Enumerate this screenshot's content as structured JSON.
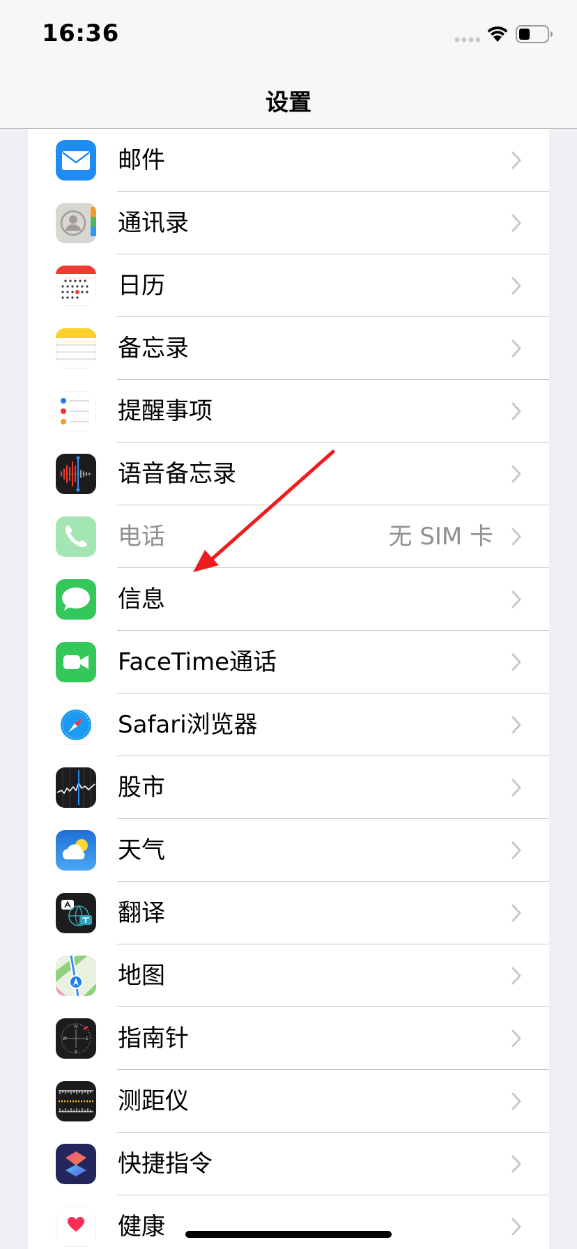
{
  "status_bar": {
    "time": "16:36",
    "battery_icon": "battery-icon",
    "wifi_icon": "wifi-icon",
    "signal_icon": "cellular-signal-icon"
  },
  "nav": {
    "title": "设置"
  },
  "colors": {
    "accent_arrow": "#ee1c1c",
    "chevron": "#c7c7cc",
    "separator": "#c8c7cc",
    "secondary_text": "#8e8e93"
  },
  "settings": [
    {
      "label": "邮件",
      "icon": "mail-icon"
    },
    {
      "label": "通讯录",
      "icon": "contacts-icon"
    },
    {
      "label": "日历",
      "icon": "calendar-icon"
    },
    {
      "label": "备忘录",
      "icon": "notes-icon"
    },
    {
      "label": "提醒事项",
      "icon": "reminders-icon"
    },
    {
      "label": "语音备忘录",
      "icon": "voice-memos-icon"
    },
    {
      "label": "电话",
      "icon": "phone-icon",
      "value": "无 SIM 卡",
      "disabled": true
    },
    {
      "label": "信息",
      "icon": "messages-icon"
    },
    {
      "label": "FaceTime通话",
      "icon": "facetime-icon"
    },
    {
      "label": "Safari浏览器",
      "icon": "safari-icon"
    },
    {
      "label": "股市",
      "icon": "stocks-icon"
    },
    {
      "label": "天气",
      "icon": "weather-icon"
    },
    {
      "label": "翻译",
      "icon": "translate-icon"
    },
    {
      "label": "地图",
      "icon": "maps-icon"
    },
    {
      "label": "指南针",
      "icon": "compass-icon"
    },
    {
      "label": "测距仪",
      "icon": "measure-icon"
    },
    {
      "label": "快捷指令",
      "icon": "shortcuts-icon"
    },
    {
      "label": "健康",
      "icon": "health-icon"
    }
  ]
}
